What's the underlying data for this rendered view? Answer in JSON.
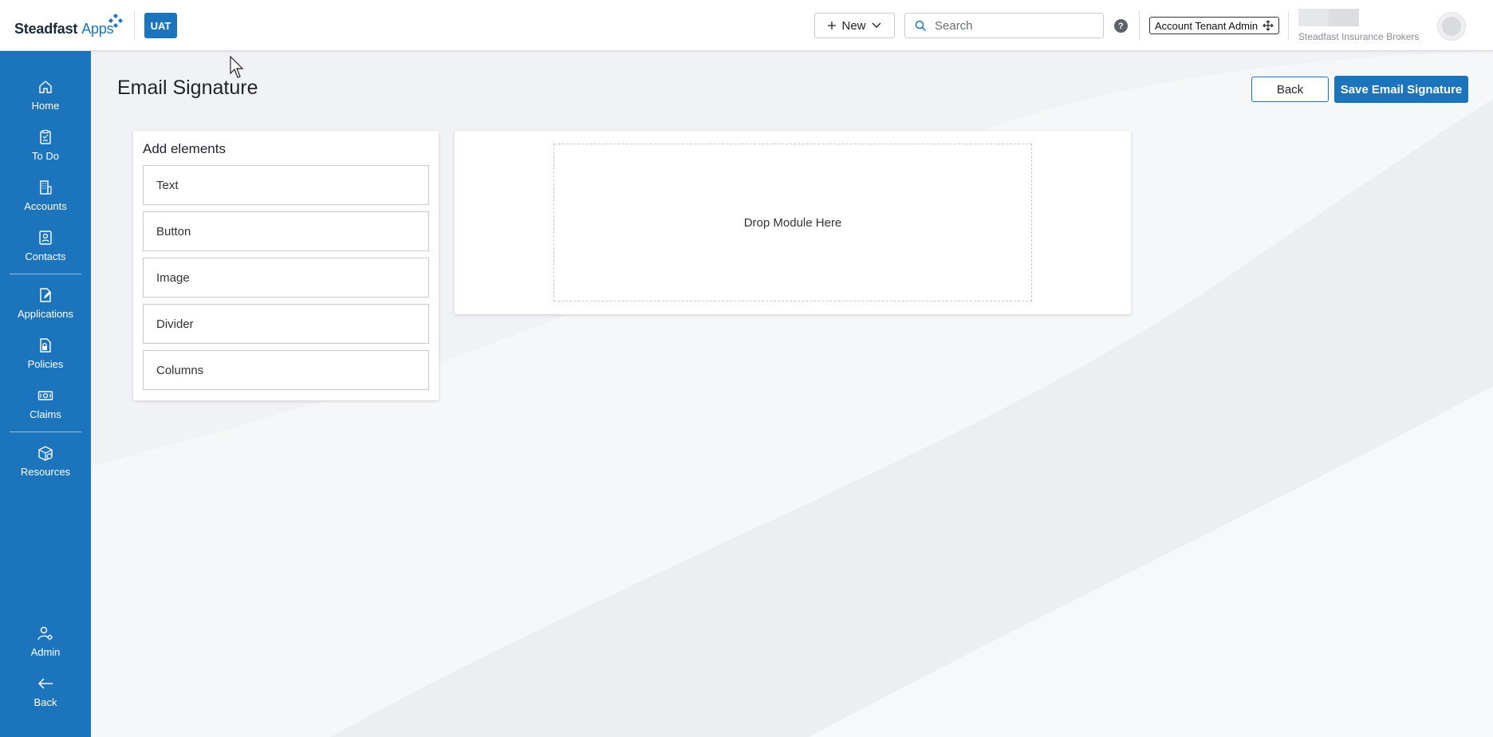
{
  "header": {
    "brand_name": "Steadfast",
    "brand_suffix": "Apps",
    "env_badge": "UAT",
    "new_label": "New",
    "search_placeholder": "Search",
    "help_symbol": "?",
    "tenant_label": "Account Tenant Admin",
    "organization": "Steadfast Insurance Brokers"
  },
  "sidebar": {
    "items": [
      {
        "label": "Home",
        "icon": "home-icon"
      },
      {
        "label": "To Do",
        "icon": "clipboard-icon"
      },
      {
        "label": "Accounts",
        "icon": "building-icon"
      },
      {
        "label": "Contacts",
        "icon": "contact-card-icon"
      },
      {
        "label": "Applications",
        "icon": "document-edit-icon"
      },
      {
        "label": "Policies",
        "icon": "document-lock-icon"
      },
      {
        "label": "Claims",
        "icon": "money-icon"
      },
      {
        "label": "Resources",
        "icon": "box-icon"
      },
      {
        "label": "Admin",
        "icon": "user-gear-icon"
      },
      {
        "label": "Back",
        "icon": "arrow-left-icon"
      }
    ]
  },
  "page": {
    "title": "Email Signature",
    "back_label": "Back",
    "save_label": "Save Email Signature"
  },
  "elements": {
    "title": "Add elements",
    "items": [
      "Text",
      "Button",
      "Image",
      "Divider",
      "Columns"
    ]
  },
  "canvas": {
    "drop_label": "Drop Module Here"
  },
  "colors": {
    "primary": "#1c75bc",
    "background": "#f1f2f5"
  }
}
